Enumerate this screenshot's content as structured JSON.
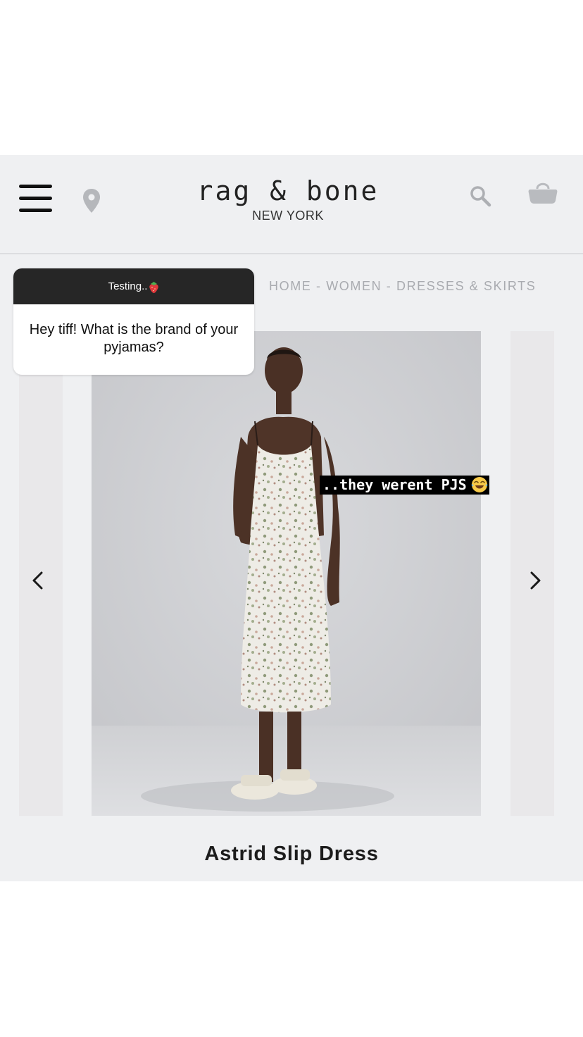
{
  "header": {
    "brand_name": "rag & bone",
    "brand_location": "NEW YORK",
    "icons": {
      "menu": "hamburger-menu-icon",
      "location": "map-pin-icon",
      "search": "search-icon",
      "cart": "shopping-bag-icon"
    }
  },
  "breadcrumb": "HOME - WOMEN - DRESSES & SKIRTS",
  "product": {
    "title": "Astrid Slip Dress"
  },
  "story_overlay": {
    "question_prompt": "Testing..",
    "question_emoji": "strawberry",
    "question_text": "Hey tiff! What is the brand of your pyjamas?",
    "caption": "..they werent PJS",
    "caption_emoji": "tears-of-joy"
  },
  "colors": {
    "page_bg": "#ffffff",
    "app_bg": "#eff0f2",
    "question_header_bg": "#262626",
    "caption_bg": "#000000",
    "breadcrumb_text": "#a9abb0"
  }
}
